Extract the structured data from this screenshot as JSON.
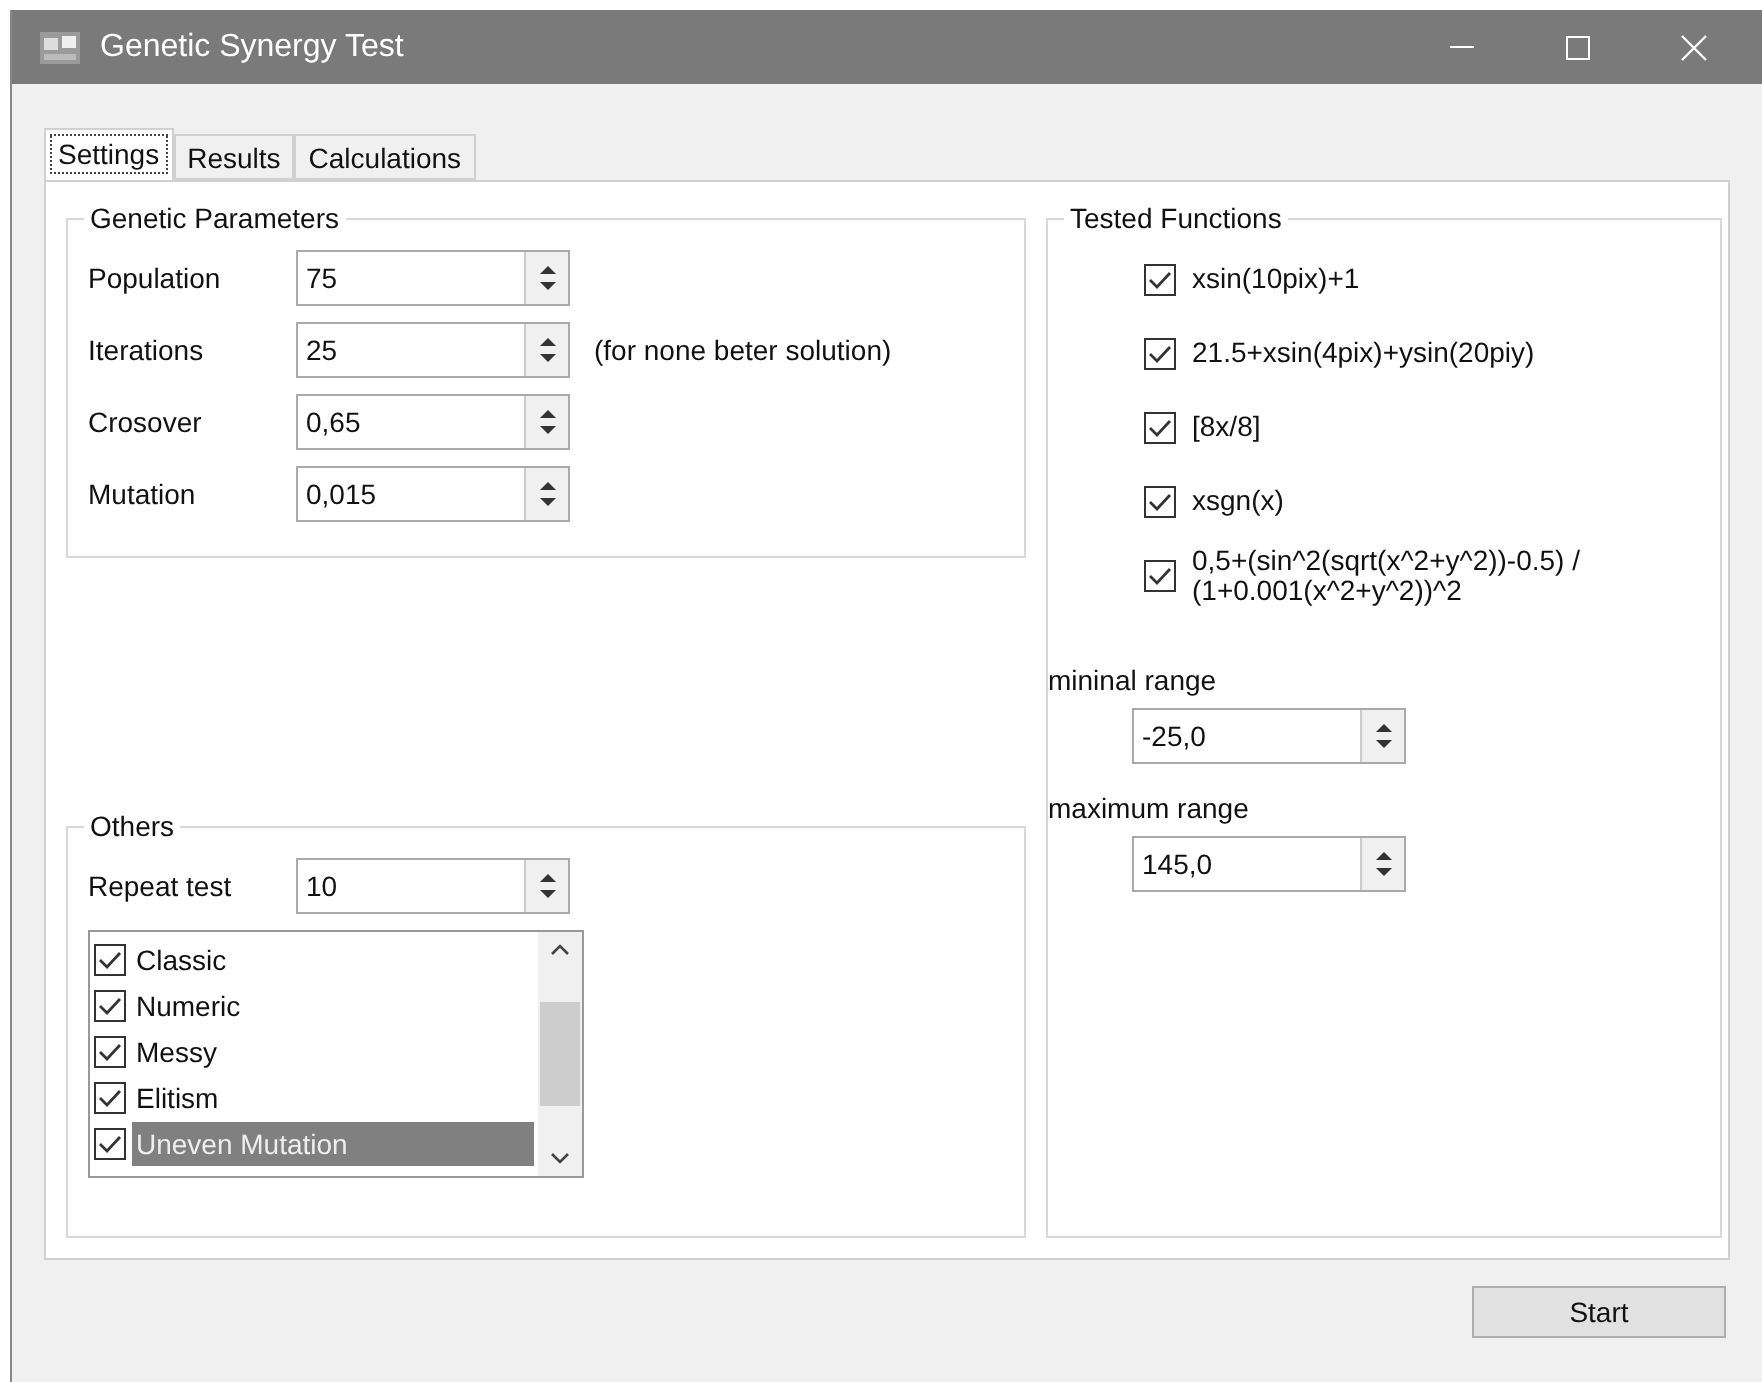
{
  "window": {
    "title": "Genetic Synergy Test"
  },
  "tabs": [
    {
      "label": "Settings",
      "selected": true
    },
    {
      "label": "Results",
      "selected": false
    },
    {
      "label": "Calculations",
      "selected": false
    }
  ],
  "genetic_parameters": {
    "title": "Genetic Parameters",
    "fields": [
      {
        "label": "Population",
        "value": "75"
      },
      {
        "label": "Iterations",
        "value": "25",
        "note": "(for none beter solution)"
      },
      {
        "label": "Crosover",
        "value": "0,65"
      },
      {
        "label": "Mutation",
        "value": "0,015"
      }
    ]
  },
  "others": {
    "title": "Others",
    "repeat_label": "Repeat test",
    "repeat_value": "10",
    "algorithms": [
      {
        "label": "Classic",
        "checked": true,
        "selected": false
      },
      {
        "label": "Numeric",
        "checked": true,
        "selected": false
      },
      {
        "label": "Messy",
        "checked": true,
        "selected": false
      },
      {
        "label": "Elitism",
        "checked": true,
        "selected": false
      },
      {
        "label": "Uneven Mutation",
        "checked": true,
        "selected": true
      }
    ]
  },
  "tested_functions": {
    "title": "Tested Functions",
    "functions": [
      {
        "label": "xsin(10pix)+1",
        "checked": true
      },
      {
        "label": "21.5+xsin(4pix)+ysin(20piy)",
        "checked": true
      },
      {
        "label": "[8x/8]",
        "checked": true
      },
      {
        "label": "xsgn(x)",
        "checked": true
      },
      {
        "label": "0,5+(sin^2(sqrt(x^2+y^2))-0.5) / (1+0.001(x^2+y^2))^2",
        "checked": true
      }
    ],
    "min_label": "mininal range",
    "min_value": "-25,0",
    "max_label": "maximum range",
    "max_value": "145,0"
  },
  "start_button": "Start"
}
